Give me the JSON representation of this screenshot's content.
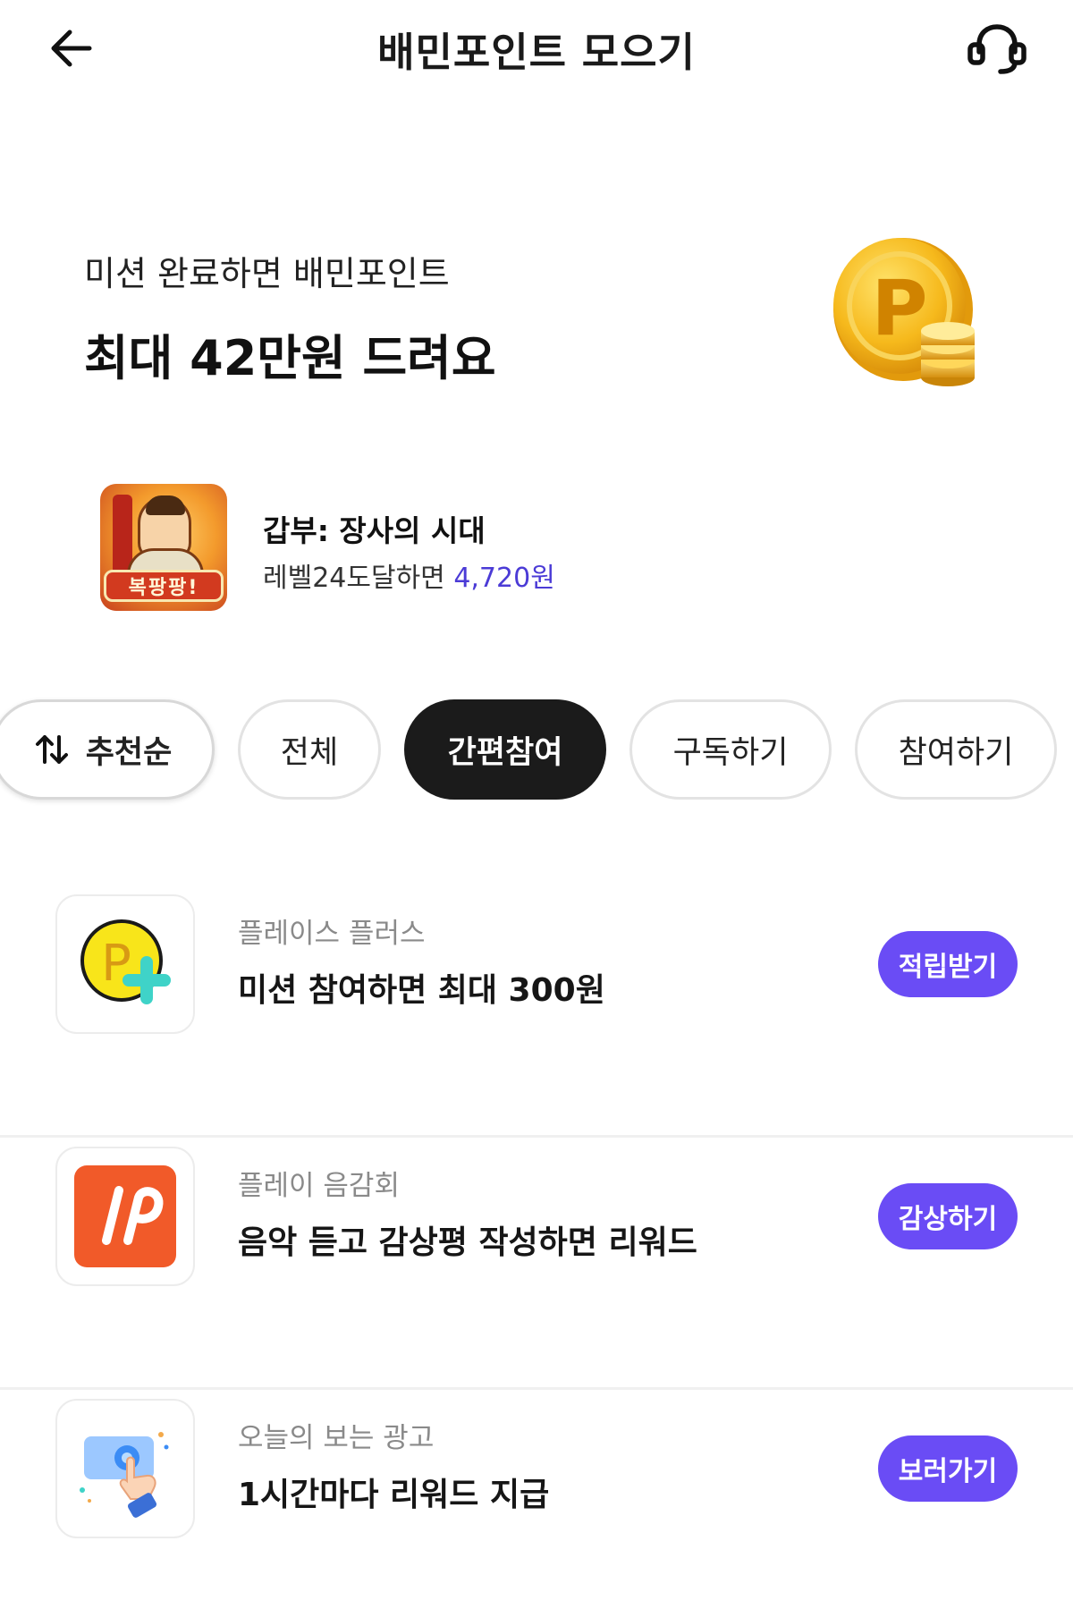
{
  "header": {
    "title": "배민포인트 모으기",
    "back_icon": "arrow-left-icon",
    "support_icon": "headset-icon"
  },
  "hero": {
    "subtitle": "미션 완료하면 배민포인트",
    "headline": "최대 42만원 드려요",
    "coin_icon": "gold-coin-icon",
    "coin_letter": "P"
  },
  "promo": {
    "title": "갑부: 장사의 시대",
    "desc": "레벨24도달하면 ",
    "amount": "4,720원",
    "badge": "복팡팡!"
  },
  "filters": {
    "sort_label": "추천순",
    "chips": [
      "전체",
      "간편참여",
      "구독하기",
      "참여하기"
    ],
    "active": "간편참여"
  },
  "items": [
    {
      "brand": "플레이스 플러스",
      "title": "미션 참여하면 최대 300원",
      "action": "적립받기",
      "icon": "place-plus-icon"
    },
    {
      "brand": "플레이 음감회",
      "title": "음악 듣고 감상평 작성하면 리워드",
      "action": "감상하기",
      "icon": "play-listening-icon"
    },
    {
      "brand": "오늘의 보는 광고",
      "title": "1시간마다 리워드 지급",
      "action": "보러가기",
      "icon": "ad-tap-icon"
    }
  ],
  "colors": {
    "accent": "#6a4cf5",
    "amount": "#4b3bd6",
    "active_chip": "#1b1b1b"
  }
}
